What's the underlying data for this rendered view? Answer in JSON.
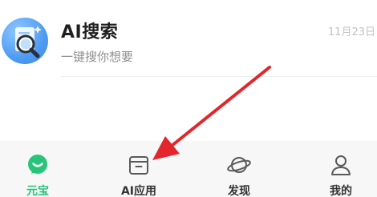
{
  "chat": {
    "title": "AI搜索",
    "preview": "一键搜你想要",
    "time": "11月23日",
    "avatar_icon": "magnifier-document-icon"
  },
  "tabs": [
    {
      "label": "元宝",
      "icon": "yuanbao-chat-icon",
      "active": true
    },
    {
      "label": "AI应用",
      "icon": "box-icon",
      "active": false
    },
    {
      "label": "发现",
      "icon": "planet-icon",
      "active": false
    },
    {
      "label": "我的",
      "icon": "person-icon",
      "active": false
    }
  ],
  "colors": {
    "accent": "#27c47a",
    "annotation_arrow": "#e3262b",
    "tab_bar_bg": "#f7f7f7"
  },
  "annotation": {
    "type": "arrow",
    "points_to": "AI应用"
  }
}
